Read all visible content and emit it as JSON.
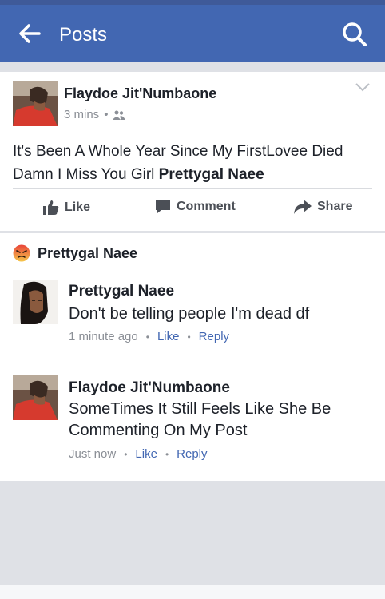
{
  "header": {
    "title": "Posts",
    "back_icon": "arrow-left-icon",
    "search_icon": "search-icon"
  },
  "post": {
    "author": "Flaydoe Jit'Numbaone",
    "time": "3 mins",
    "separator": "•",
    "audience_icon": "friends-icon",
    "text_main": "It's Been A Whole Year Since My FirstLovee Died Damn I Miss You Girl ",
    "tagged": "Prettygal Naee",
    "actions": {
      "like": "Like",
      "comment": "Comment",
      "share": "Share"
    }
  },
  "comments_section": {
    "reaction": {
      "emoji": "angry-face-icon",
      "name": "Prettygal Naee"
    },
    "comments": [
      {
        "name": "Prettygal Naee",
        "text": "Don't be telling people I'm dead df",
        "time": "1 minute ago",
        "like": "Like",
        "reply": "Reply"
      },
      {
        "name": "Flaydoe Jit'Numbaone",
        "text": "SomeTimes It Still Feels Like She Be Commenting On My Post",
        "time": "Just now",
        "like": "Like",
        "reply": "Reply"
      }
    ]
  },
  "colors": {
    "brand": "#4267b2",
    "text": "#1d2129",
    "muted": "#8b8f96",
    "background": "#dfe1e6"
  }
}
